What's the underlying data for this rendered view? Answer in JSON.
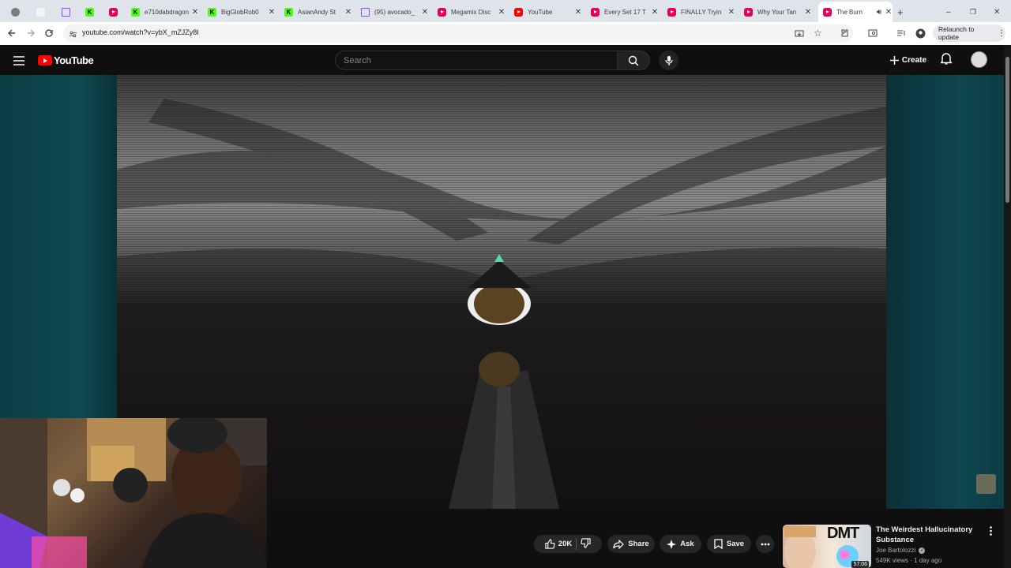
{
  "browser": {
    "tabs": [
      {
        "title": "",
        "favicon": "gray-circle"
      },
      {
        "title": "",
        "favicon": "blank"
      },
      {
        "title": "",
        "favicon": "twitch"
      },
      {
        "title": "",
        "favicon": "kick"
      },
      {
        "title": "",
        "favicon": "youtube"
      },
      {
        "title": "e710dabdragon",
        "favicon": "kick"
      },
      {
        "title": "BigGlobRob0",
        "favicon": "kick"
      },
      {
        "title": "AsianAndy St",
        "favicon": "kick"
      },
      {
        "title": "(95) avocado_",
        "favicon": "twitch"
      },
      {
        "title": "Megamix Disc",
        "favicon": "youtube"
      },
      {
        "title": "YouTube",
        "favicon": "youtube"
      },
      {
        "title": "Every Set 17 T",
        "favicon": "youtube"
      },
      {
        "title": "FINALLY Tryin",
        "favicon": "youtube"
      },
      {
        "title": "Why Your Tan",
        "favicon": "youtube"
      },
      {
        "title": "The Burn",
        "favicon": "youtube",
        "active": true
      }
    ],
    "new_tab_symbol": "+",
    "url": "youtube.com/watch?v=ybX_mZJZy8I",
    "relaunch_label": "Relaunch to update"
  },
  "youtube": {
    "logo_text": "YouTube",
    "search_placeholder": "Search",
    "create_label": "Create"
  },
  "actions": {
    "like_count": "20K",
    "share_label": "Share",
    "ask_label": "Ask",
    "save_label": "Save"
  },
  "recommended": {
    "title": "The Weirdest Hallucinatory Substance",
    "thumb_text": "DMT",
    "channel": "Joe Bartolozzi",
    "meta": "549K views · 1 day ago",
    "duration": "57:06"
  },
  "colors": {
    "accent_red": "#ff0000",
    "kick_green": "#53fc18",
    "twitch_purple": "#9146ff",
    "bg": "#0f0f0f"
  }
}
